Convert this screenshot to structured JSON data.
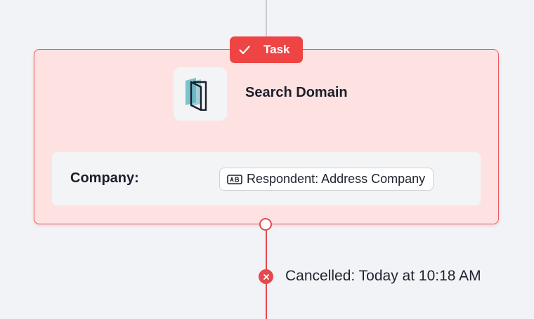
{
  "task": {
    "badge_label": "Task",
    "badge_icon": "check-icon",
    "app_icon": "search-domain-app-icon",
    "title": "Search Domain",
    "field": {
      "label": "Company:",
      "value_icon": "text-field-icon",
      "value": "Respondent: Address Company"
    }
  },
  "status": {
    "icon": "x-icon",
    "text": "Cancelled: Today at 10:18 AM"
  },
  "colors": {
    "accent": "#ef4444",
    "card_background": "#fee2e2",
    "card_border": "#ec5a5f",
    "canvas_background": "#f1f3f6"
  }
}
